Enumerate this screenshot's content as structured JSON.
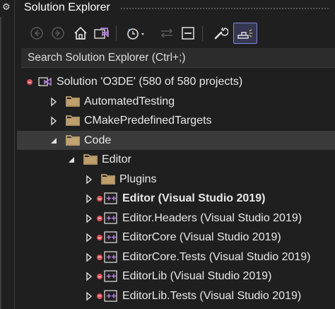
{
  "window": {
    "title": "Solution Explorer",
    "left_panel_icon": "gear-icon"
  },
  "toolbar": {
    "buttons": [
      {
        "name": "back-button",
        "icon": "arrow-left-icon"
      },
      {
        "name": "forward-button",
        "icon": "arrow-right-icon"
      },
      {
        "name": "home-button",
        "icon": "home-icon"
      },
      {
        "name": "switch-views-button",
        "icon": "visual-studio-solution-icon"
      },
      {
        "name": "pending-changes-filter-button",
        "icon": "clock-filter-icon"
      },
      {
        "name": "sync-with-active-document-button",
        "icon": "sync-arrows-icon"
      },
      {
        "name": "collapse-all-button",
        "icon": "collapse-icon"
      },
      {
        "name": "properties-button",
        "icon": "wrench-icon"
      },
      {
        "name": "preview-selected-items-button",
        "icon": "preview-icon"
      }
    ],
    "active_button": "preview-selected-items-button"
  },
  "search": {
    "placeholder": "Search Solution Explorer (Ctrl+;)"
  },
  "tree": {
    "items": [
      {
        "label": "Solution 'O3DE' (580 of 580 projects)",
        "type": "solution",
        "level": 0,
        "arrow": "none",
        "status": "error",
        "bold": false,
        "selected": false
      },
      {
        "label": "AutomatedTesting",
        "type": "folder",
        "level": 1,
        "arrow": "collapsed",
        "status": "",
        "bold": false,
        "selected": false
      },
      {
        "label": "CMakePredefinedTargets",
        "type": "folder",
        "level": 1,
        "arrow": "collapsed",
        "status": "",
        "bold": false,
        "selected": false
      },
      {
        "label": "Code",
        "type": "folder",
        "level": 1,
        "arrow": "expanded",
        "status": "",
        "bold": false,
        "selected": true
      },
      {
        "label": "Editor",
        "type": "folder",
        "level": 2,
        "arrow": "expanded",
        "status": "",
        "bold": false,
        "selected": false
      },
      {
        "label": "Plugins",
        "type": "folder",
        "level": 3,
        "arrow": "collapsed",
        "status": "",
        "bold": false,
        "selected": false
      },
      {
        "label": "Editor (Visual Studio 2019)",
        "type": "cpp-project",
        "level": 3,
        "arrow": "collapsed",
        "status": "error",
        "bold": true,
        "selected": false
      },
      {
        "label": "Editor.Headers (Visual Studio 2019)",
        "type": "cpp-project",
        "level": 3,
        "arrow": "collapsed",
        "status": "error",
        "bold": false,
        "selected": false
      },
      {
        "label": "EditorCore (Visual Studio 2019)",
        "type": "cpp-project",
        "level": 3,
        "arrow": "collapsed",
        "status": "error",
        "bold": false,
        "selected": false
      },
      {
        "label": "EditorCore.Tests (Visual Studio 2019)",
        "type": "cpp-project",
        "level": 3,
        "arrow": "collapsed",
        "status": "error",
        "bold": false,
        "selected": false
      },
      {
        "label": "EditorLib (Visual Studio 2019)",
        "type": "cpp-project",
        "level": 3,
        "arrow": "collapsed",
        "status": "error",
        "bold": false,
        "selected": false
      },
      {
        "label": "EditorLib.Tests (Visual Studio 2019)",
        "type": "cpp-project",
        "level": 3,
        "arrow": "collapsed",
        "status": "error",
        "bold": false,
        "selected": false
      }
    ]
  },
  "colors": {
    "background": "#1f1f1f",
    "folder": "#dcb67a",
    "error_badge": "#e2505a",
    "project_icon": "#b180d7",
    "accent": "#7f86d8",
    "selected_row": "#3a3a3a"
  }
}
